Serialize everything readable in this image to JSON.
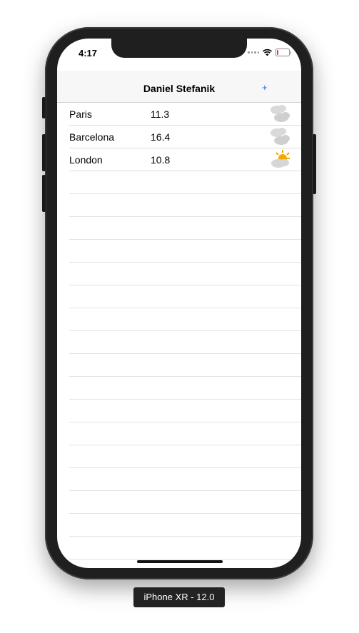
{
  "status_bar": {
    "time": "4:17"
  },
  "nav": {
    "title": "Daniel Stefanik",
    "add_label": "+"
  },
  "cities": [
    {
      "name": "Paris",
      "temp": "11.3",
      "icon": "cloudy-icon"
    },
    {
      "name": "Barcelona",
      "temp": "16.4",
      "icon": "cloudy-icon"
    },
    {
      "name": "London",
      "temp": "10.8",
      "icon": "partly-sunny-icon"
    }
  ],
  "device_label": "iPhone XR - 12.0",
  "colors": {
    "accent": "#1a73e8",
    "battery_low": "#e03b2f",
    "sun": "#f2a900"
  }
}
